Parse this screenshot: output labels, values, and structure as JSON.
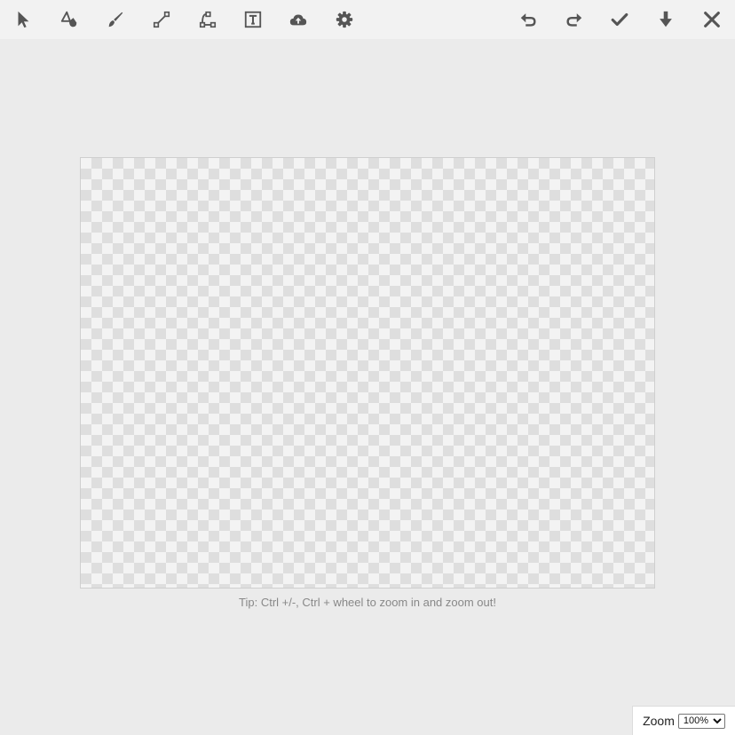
{
  "toolbar": {
    "left_tools": [
      {
        "name": "select-tool",
        "icon": "pointer-arrow-icon"
      },
      {
        "name": "fill-tool",
        "icon": "paint-bucket-icon"
      },
      {
        "name": "brush-tool",
        "icon": "paint-brush-icon"
      },
      {
        "name": "line-tool",
        "icon": "line-segment-icon"
      },
      {
        "name": "curve-tool",
        "icon": "bezier-curve-icon"
      },
      {
        "name": "text-tool",
        "icon": "text-box-icon"
      },
      {
        "name": "upload-tool",
        "icon": "cloud-upload-icon"
      },
      {
        "name": "settings-tool",
        "icon": "gear-icon"
      }
    ],
    "right_tools": [
      {
        "name": "undo",
        "icon": "undo-arrow-icon"
      },
      {
        "name": "redo",
        "icon": "redo-arrow-icon"
      },
      {
        "name": "confirm",
        "icon": "check-icon"
      },
      {
        "name": "download",
        "icon": "download-arrow-icon"
      },
      {
        "name": "close",
        "icon": "close-icon"
      }
    ],
    "icon_color": "#555555"
  },
  "canvas": {
    "background": "transparent-checkerboard"
  },
  "tip": "Tip: Ctrl +/-, Ctrl + wheel to zoom in and zoom out!",
  "zoom": {
    "label": "Zoom",
    "selected": "100%",
    "options": [
      "100%"
    ]
  }
}
